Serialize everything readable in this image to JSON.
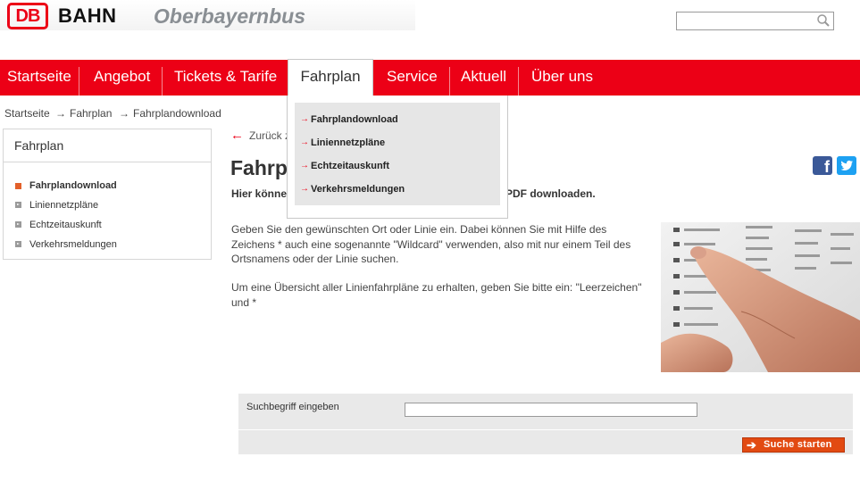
{
  "header": {
    "logo_text": "DB",
    "bahn_text": "BAHN",
    "brand_name": "Oberbayernbus",
    "search": {
      "placeholder": ""
    }
  },
  "nav": {
    "items": [
      "Startseite",
      "Angebot",
      "Tickets & Tarife",
      "Fahrplan",
      "Service",
      "Aktuell",
      "Über uns"
    ],
    "active": "Fahrplan"
  },
  "dropdown": {
    "items": [
      "Fahrplandownload",
      "Liniennetzpläne",
      "Echtzeitauskunft",
      "Verkehrsmeldungen"
    ]
  },
  "breadcrumb": [
    "Startseite",
    "Fahrplan",
    "Fahrplandownload"
  ],
  "sidebar": {
    "title": "Fahrplan",
    "items": [
      {
        "label": "Fahrplandownload",
        "active": true
      },
      {
        "label": "Liniennetzpläne",
        "active": false
      },
      {
        "label": "Echtzeitauskunft",
        "active": false
      },
      {
        "label": "Verkehrsmeldungen",
        "active": false
      }
    ]
  },
  "main": {
    "back_link": "Zurück z",
    "title": "Fahrp",
    "intro_left": "Hier könne",
    "intro_right": "PDF downloaden.",
    "paragraph_1": "Geben Sie den gewünschten Ort oder Linie ein. Dabei können Sie mit Hilfe des Zeichens * auch eine sogenannte \"Wildcard\" verwenden, also mit nur einem Teil des Ortsnamens oder der Linie suchen.",
    "paragraph_2": "Um eine Übersicht aller Linienfahrpläne zu erhalten, geben Sie bitte ein: \"Leerzeichen\" und *"
  },
  "social": {
    "facebook_letter": "f"
  },
  "search_form": {
    "label": "Suchbegriff eingeben",
    "value": "",
    "submit_label": "Suche starten"
  },
  "colors": {
    "brand_red": "#ec0016",
    "button_orange": "#e24a12",
    "form_bg": "#e9e9e9"
  }
}
